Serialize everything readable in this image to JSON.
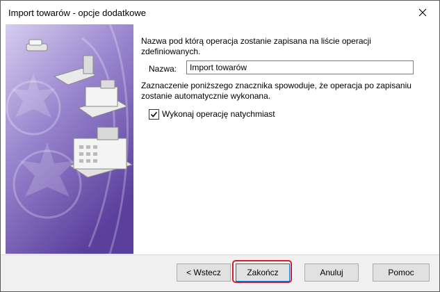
{
  "window": {
    "title": "Import towarów - opcje dodatkowe"
  },
  "content": {
    "description_name": "Nazwa pod którą operacja zostanie zapisana na liście operacji zdefiniowanych.",
    "name_label": "Nazwa:",
    "name_value": "Import towarów",
    "description_checkbox": "Zaznaczenie poniższego znacznika spowoduje, że operacja po zapisaniu zostanie automatycznie wykonana.",
    "checkbox_label": "Wykonaj operację natychmiast",
    "checkbox_checked": true
  },
  "buttons": {
    "back": "< Wstecz",
    "finish": "Zakończ",
    "cancel": "Anuluj",
    "help": "Pomoc"
  },
  "colors": {
    "side_gradient_top": "#c9bfe6",
    "side_gradient_bottom": "#5a3f9c",
    "highlight": "#d51c2e",
    "focus": "#0078d7"
  },
  "icons": {
    "close": "close-icon",
    "checkmark": "checkmark-icon"
  }
}
